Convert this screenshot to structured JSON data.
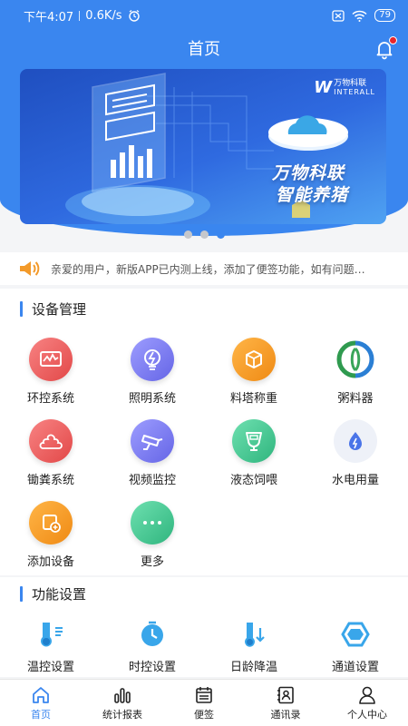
{
  "status_bar": {
    "time": "下午4:07",
    "speed": "0.6K/s",
    "battery": "79",
    "icons": [
      "alarm-icon",
      "sim-off-icon",
      "wifi-icon",
      "battery-icon"
    ]
  },
  "header": {
    "title": "首页",
    "bell_icon": "bell-icon",
    "badge_color": "#e8262c"
  },
  "banner": {
    "brand_cn": "万物科联",
    "brand_en": "INTERALL",
    "brand_mark": "W",
    "line1": "万物科联",
    "line2": "智能养猪",
    "slide_count": 3,
    "active_slide": 3
  },
  "notice": {
    "icon": "speaker-icon",
    "text": "亲爱的用户，新版APP已内测上线，添加了便签功能，如有问题…"
  },
  "device_section": {
    "title": "设备管理",
    "items": [
      {
        "label": "环控系统",
        "icon": "env-control-icon",
        "color": "#ef5a5a"
      },
      {
        "label": "照明系统",
        "icon": "lighting-icon",
        "color": "#7f7ff0"
      },
      {
        "label": "料塔称重",
        "icon": "feed-tower-icon",
        "color": "#f39a2a"
      },
      {
        "label": "粥料器",
        "icon": "porridge-feeder-icon",
        "color": "#3aa55a"
      },
      {
        "label": "锄粪系统",
        "icon": "manure-icon",
        "color": "#ef5a5a"
      },
      {
        "label": "视频监控",
        "icon": "camera-icon",
        "color": "#7f7ff0"
      },
      {
        "label": "液态饲喂",
        "icon": "liquid-feed-icon",
        "color": "#3fc490"
      },
      {
        "label": "水电用量",
        "icon": "water-electric-icon",
        "color": "#3a86ef"
      },
      {
        "label": "添加设备",
        "icon": "add-device-icon",
        "color": "#f39a2a"
      },
      {
        "label": "更多",
        "icon": "more-icon",
        "color": "#3fc490"
      }
    ]
  },
  "function_section": {
    "title": "功能设置",
    "items": [
      {
        "label": "温控设置",
        "icon": "thermo-control-icon"
      },
      {
        "label": "时控设置",
        "icon": "timer-icon"
      },
      {
        "label": "日龄降温",
        "icon": "age-cooling-icon"
      },
      {
        "label": "通道设置",
        "icon": "channel-icon"
      }
    ]
  },
  "tab_bar": {
    "tabs": [
      {
        "label": "首页",
        "icon": "home-icon",
        "active": true
      },
      {
        "label": "统计报表",
        "icon": "bar-chart-icon",
        "active": false
      },
      {
        "label": "便签",
        "icon": "calendar-icon",
        "active": false
      },
      {
        "label": "通讯录",
        "icon": "contacts-icon",
        "active": false
      },
      {
        "label": "个人中心",
        "icon": "user-icon",
        "active": false
      }
    ]
  },
  "colors": {
    "primary": "#3a86ef",
    "background": "#f4f5f7"
  }
}
